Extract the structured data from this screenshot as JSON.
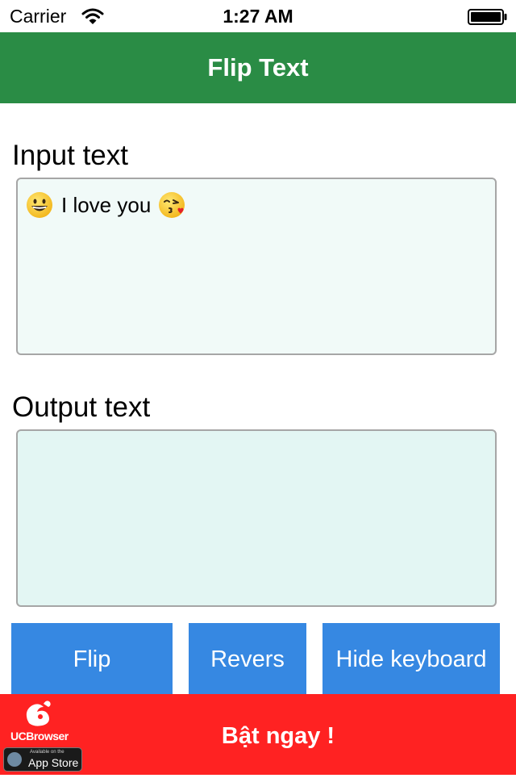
{
  "status_bar": {
    "carrier": "Carrier",
    "time": "1:27 AM"
  },
  "nav": {
    "title": "Flip Text"
  },
  "input_section": {
    "label": "Input text",
    "text": "I love you",
    "leading_emoji": "grinning-face",
    "trailing_emoji": "face-blowing-a-kiss"
  },
  "output_section": {
    "label": "Output text",
    "text": ""
  },
  "buttons": {
    "flip": "Flip",
    "revers": "Revers",
    "hide_keyboard": "Hide keyboard"
  },
  "ad": {
    "brand": "UCBrowser",
    "store_small": "Available on the",
    "store_big": "App Store",
    "cta": "Bật ngay !"
  },
  "colors": {
    "nav_background": "#2a8c45",
    "button_background": "#3688e2",
    "ad_background": "#ff2222",
    "input_box_background": "#f1faf8",
    "output_box_background": "#e3f6f3"
  }
}
